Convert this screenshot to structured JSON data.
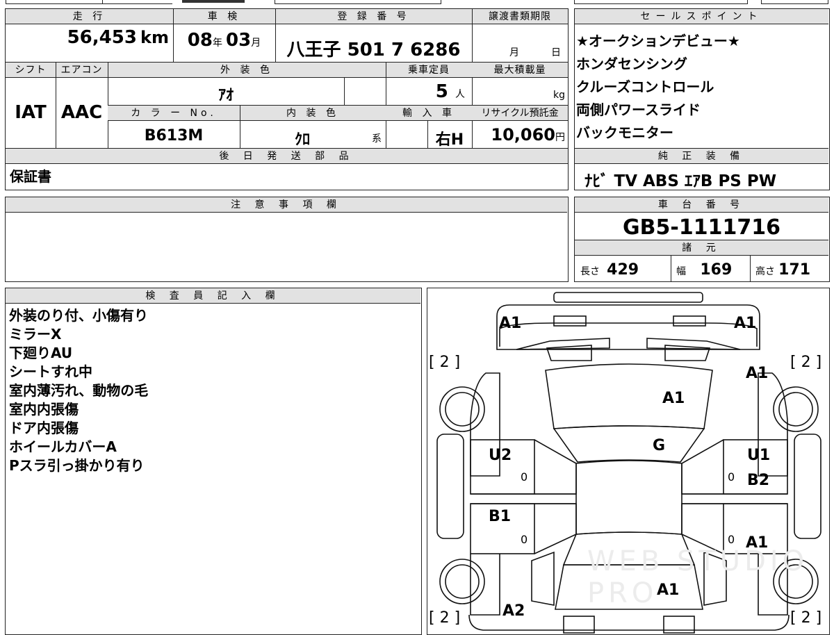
{
  "top_table": {
    "mileage": {
      "header": "走 行",
      "value": "56,453",
      "unit": "km"
    },
    "inspection": {
      "header": "車 検",
      "year": "08",
      "year_unit": "年",
      "month": "03",
      "month_unit": "月"
    },
    "registration": {
      "header": "登 録 番 号",
      "value": "八王子 501 7 6286"
    },
    "transfer_deadline": {
      "header": "譲渡書類期限",
      "month_unit": "月",
      "day_unit": "日"
    },
    "shift": {
      "header": "シフト",
      "value": "IAT"
    },
    "aircon": {
      "header": "エアコン",
      "value": "AAC"
    },
    "exterior_color": {
      "header": "外 装 色",
      "value": "ｱｵ"
    },
    "capacity": {
      "header": "乗車定員",
      "value": "5",
      "unit": "人"
    },
    "max_load": {
      "header": "最大積載量",
      "unit": "kg"
    },
    "color_no": {
      "header": "カ ラ ー No.",
      "value": "B613M"
    },
    "interior_color": {
      "header": "内 装 色",
      "value": "ｸﾛ",
      "suffix": "系"
    },
    "import": {
      "header": "輸 入 車",
      "value": "右H"
    },
    "recycle": {
      "header": "リサイクル預託金",
      "value": "10,060",
      "unit": "円"
    },
    "later_parts": {
      "header": "後 日 発 送 部 品",
      "value": "保証書"
    }
  },
  "sales_points": {
    "header": "セールスポイント",
    "items": [
      "★オークションデビュー★",
      "ホンダセンシング",
      "クルーズコントロール",
      "両側パワースライド",
      "バックモニター"
    ]
  },
  "equipment": {
    "header": "純 正 装 備",
    "value": "ﾅﾋﾞ TV ABS ｴｱB PS PW"
  },
  "caution": {
    "header": "注 意 事 項 欄"
  },
  "chassis": {
    "header": "車 台 番 号",
    "value": "GB5-1111716"
  },
  "specs": {
    "header": "諸 元",
    "length_label": "長さ",
    "length": "429",
    "width_label": "幅",
    "width": "169",
    "height_label": "高さ",
    "height": "171"
  },
  "inspector": {
    "header": "検 査 員 記 入 欄",
    "notes": [
      "外装のり付、小傷有り",
      "ミラーX",
      "下廻りAU",
      "シートすれ中",
      "室内薄汚れ、動物の毛",
      "室内内張傷",
      "ドア内張傷",
      "ホイールカバーA",
      "Pスラ引っ掛かり有り"
    ]
  },
  "diagram": {
    "marks": {
      "front_left_corner": "A1",
      "front_right_corner": "A1",
      "tire_front_left": "[ 2 ]",
      "tire_front_right": "[ 2 ]",
      "fender_right": "A1",
      "hood": "A1",
      "windshield": "G",
      "door_front_left": "U2",
      "door_front_right": "U1",
      "door_front_right_2": "B2",
      "door_rear_left": "B1",
      "door_rear_right": "A1",
      "roof_rear": "A1",
      "rear_left": "A2",
      "tire_rear_left": "[ 2 ]",
      "tire_rear_right": "[ 2 ]",
      "zero_1": "0",
      "zero_2": "0",
      "zero_3": "0",
      "zero_4": "0"
    },
    "watermark": "WEB STUDIO PRO"
  }
}
